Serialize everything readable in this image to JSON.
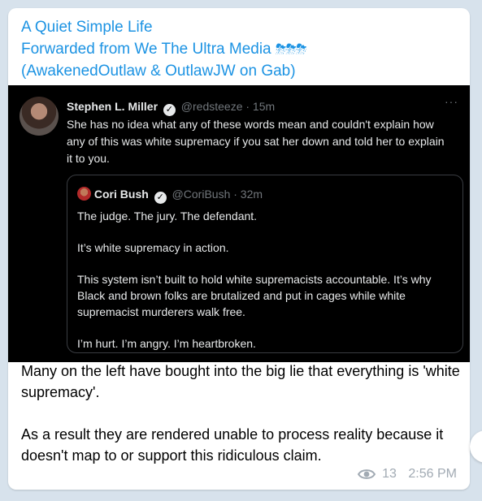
{
  "header": {
    "channel_name": "A Quiet Simple Life",
    "forwarded_line": "Forwarded from We The Ultra Media",
    "forward_emoji": "⛈⛈⛈",
    "source_handles": "(AwakenedOutlaw & OutlawJW on Gab)"
  },
  "tweet": {
    "author_name": "Stephen L. Miller",
    "verified_mark": "✓",
    "handle_time": "@redsteeze · 15m",
    "more": "···",
    "text": "She has no idea what any of these words mean and couldn't explain how any of this was white supremacy if you sat her down and told her to explain it to you.",
    "quoted": {
      "author_name": "Cori Bush",
      "handle_time": "@CoriBush · 32m",
      "paragraphs": [
        "The judge. The jury. The defendant.",
        "It’s white supremacy in action.",
        "This system isn’t built to hold white supremacists accountable. It’s why Black and brown folks are brutalized and put in cages while white supremacist murderers walk free.",
        "I’m hurt. I’m angry. I’m heartbroken."
      ]
    }
  },
  "caption": {
    "paragraph_1": "Many on the left have bought into the big lie that everything is 'white supremacy'.",
    "paragraph_2": "As a result they are rendered unable to process reality because it doesn't map to or support this ridiculous claim."
  },
  "meta": {
    "views": "13",
    "time": "2:56 PM",
    "views_icon": "eye-icon"
  },
  "colors": {
    "link_blue": "#1c93e3",
    "meta_gray": "#a1aab3",
    "chat_background": "#d7e2ec",
    "tweet_background": "#000000"
  }
}
